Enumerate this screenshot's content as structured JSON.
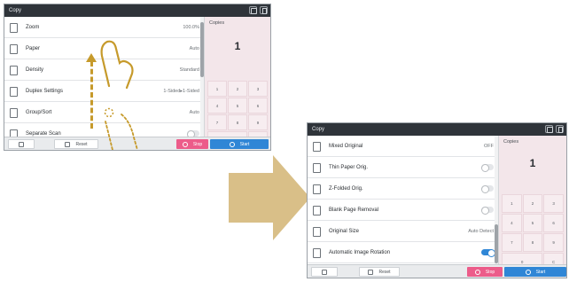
{
  "colors": {
    "accent_blue": "#2f86d6",
    "stop_pink": "#ec5c8a",
    "arrow_tan": "#d9bf88",
    "gesture_gold": "#c69a2b"
  },
  "screen1": {
    "title": "Copy",
    "rows": [
      {
        "label": "Zoom",
        "value": "100.0%",
        "icon": "zoom-icon"
      },
      {
        "label": "Paper",
        "value": "Auto",
        "icon": "paper-icon"
      },
      {
        "label": "Density",
        "value": "Standard",
        "icon": "density-icon"
      },
      {
        "label": "Duplex Settings",
        "value": "1-Sided▸1-Sided",
        "icon": "duplex-icon"
      },
      {
        "label": "Group/Sort",
        "value": "Auto",
        "icon": "group-sort-icon"
      },
      {
        "label": "Separate Scan",
        "value": "",
        "icon": "separate-scan-icon",
        "toggle": "off"
      }
    ],
    "copies_label": "Copies",
    "copies_value": "1",
    "keypad": [
      "1",
      "2",
      "3",
      "4",
      "5",
      "6",
      "7",
      "8",
      "9",
      "0",
      "C"
    ],
    "reset_label": "Reset",
    "stop_label": "Stop",
    "start_label": "Start"
  },
  "screen2": {
    "title": "Copy",
    "rows": [
      {
        "label": "Mixed Original",
        "value": "OFF",
        "icon": "mixed-original-icon"
      },
      {
        "label": "Thin Paper Orig.",
        "value": "",
        "icon": "thin-paper-icon",
        "toggle": "off"
      },
      {
        "label": "Z-Folded Orig.",
        "value": "",
        "icon": "z-folded-icon",
        "toggle": "off"
      },
      {
        "label": "Blank Page Removal",
        "value": "",
        "icon": "blank-page-icon",
        "toggle": "off"
      },
      {
        "label": "Original Size",
        "value": "Auto Detect",
        "icon": "original-size-icon"
      },
      {
        "label": "Automatic Image Rotation",
        "value": "",
        "icon": "image-rotation-icon",
        "toggle": "on"
      }
    ],
    "copies_label": "Copies",
    "copies_value": "1",
    "keypad": [
      "1",
      "2",
      "3",
      "4",
      "5",
      "6",
      "7",
      "8",
      "9",
      "0",
      "C"
    ],
    "reset_label": "Reset",
    "stop_label": "Stop",
    "start_label": "Start"
  }
}
